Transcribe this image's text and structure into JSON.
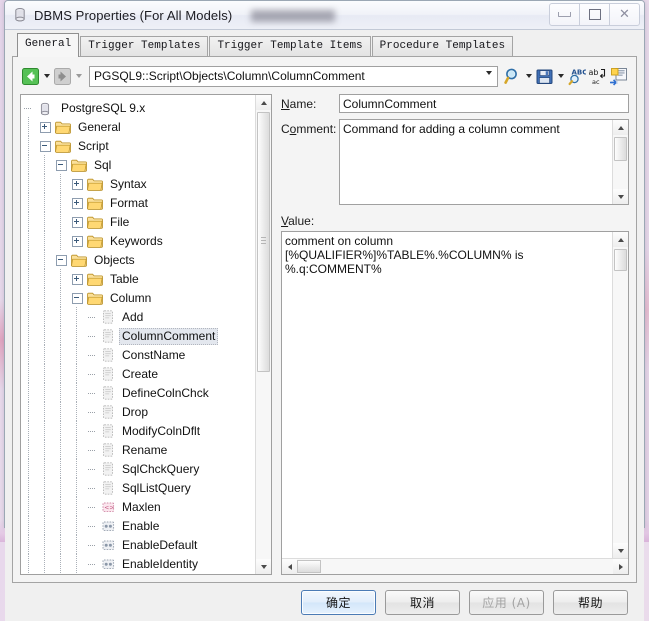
{
  "window": {
    "title": "DBMS Properties (For All Models)",
    "title_icon": "database-cylinder-icon",
    "minimize_label": "Minimize",
    "maximize_label": "Maximize",
    "close_label": "Close"
  },
  "tabs": [
    {
      "label": "General",
      "active": true
    },
    {
      "label": "Trigger Templates",
      "active": false
    },
    {
      "label": "Trigger Template Items",
      "active": false
    },
    {
      "label": "Procedure Templates",
      "active": false
    }
  ],
  "toolbar": {
    "back_icon": "back-arrow-icon",
    "forward_icon": "forward-arrow-icon",
    "path_value": "PGSQL9::Script\\Objects\\Column\\ColumnComment",
    "path_placeholder": "",
    "find_icon": "magnifier-icon",
    "save_icon": "floppy-disk-icon",
    "spellcheck_icon": "abc-spellcheck-icon",
    "replace_icon": "ab-ac-replace-icon",
    "insert_icon": "insert-template-icon"
  },
  "tree": {
    "root_icon": "database-cylinder-icon",
    "nodes": [
      {
        "label": "PostgreSQL 9.x",
        "depth": 0,
        "icon": "database-cylinder-icon",
        "expander": "none",
        "selected": false
      },
      {
        "label": "General",
        "depth": 1,
        "icon": "folder-icon",
        "expander": "plus",
        "selected": false
      },
      {
        "label": "Script",
        "depth": 1,
        "icon": "folder-icon",
        "expander": "minus",
        "selected": false
      },
      {
        "label": "Sql",
        "depth": 2,
        "icon": "folder-icon",
        "expander": "minus",
        "selected": false
      },
      {
        "label": "Syntax",
        "depth": 3,
        "icon": "folder-icon",
        "expander": "plus",
        "selected": false
      },
      {
        "label": "Format",
        "depth": 3,
        "icon": "folder-icon",
        "expander": "plus",
        "selected": false
      },
      {
        "label": "File",
        "depth": 3,
        "icon": "folder-icon",
        "expander": "plus",
        "selected": false
      },
      {
        "label": "Keywords",
        "depth": 3,
        "icon": "folder-icon",
        "expander": "plus",
        "selected": false
      },
      {
        "label": "Objects",
        "depth": 2,
        "icon": "folder-icon",
        "expander": "minus",
        "selected": false
      },
      {
        "label": "Table",
        "depth": 3,
        "icon": "folder-icon",
        "expander": "plus",
        "selected": false
      },
      {
        "label": "Column",
        "depth": 3,
        "icon": "folder-icon",
        "expander": "minus",
        "selected": false
      },
      {
        "label": "Add",
        "depth": 4,
        "icon": "script-item-icon",
        "expander": "none",
        "selected": false
      },
      {
        "label": "ColumnComment",
        "depth": 4,
        "icon": "script-item-icon",
        "expander": "none",
        "selected": true
      },
      {
        "label": "ConstName",
        "depth": 4,
        "icon": "script-item-icon",
        "expander": "none",
        "selected": false
      },
      {
        "label": "Create",
        "depth": 4,
        "icon": "script-item-icon",
        "expander": "none",
        "selected": false
      },
      {
        "label": "DefineColnChck",
        "depth": 4,
        "icon": "script-item-icon",
        "expander": "none",
        "selected": false
      },
      {
        "label": "Drop",
        "depth": 4,
        "icon": "script-item-icon",
        "expander": "none",
        "selected": false
      },
      {
        "label": "ModifyColnDflt",
        "depth": 4,
        "icon": "script-item-icon",
        "expander": "none",
        "selected": false
      },
      {
        "label": "Rename",
        "depth": 4,
        "icon": "script-item-icon",
        "expander": "none",
        "selected": false
      },
      {
        "label": "SqlChckQuery",
        "depth": 4,
        "icon": "script-item-icon",
        "expander": "none",
        "selected": false
      },
      {
        "label": "SqlListQuery",
        "depth": 4,
        "icon": "script-item-icon",
        "expander": "none",
        "selected": false
      },
      {
        "label": "Maxlen",
        "depth": 4,
        "icon": "number-value-icon",
        "expander": "none",
        "selected": false
      },
      {
        "label": "Enable",
        "depth": 4,
        "icon": "boolean-value-icon",
        "expander": "none",
        "selected": false
      },
      {
        "label": "EnableDefault",
        "depth": 4,
        "icon": "boolean-value-icon",
        "expander": "none",
        "selected": false
      },
      {
        "label": "EnableIdentity",
        "depth": 4,
        "icon": "boolean-value-icon",
        "expander": "none",
        "selected": false
      }
    ]
  },
  "form": {
    "name_label": "Name:",
    "name_accel": "N",
    "name_value": "ColumnComment",
    "comment_label": "Comment:",
    "comment_accel": "o",
    "comment_value": "Command for adding a column comment",
    "value_label": "Value:",
    "value_accel": "V",
    "value_value": "comment on column  [%QUALIFIER%]%TABLE%.%COLUMN% is %.q:COMMENT%"
  },
  "footer": {
    "ok_label": "确定",
    "cancel_label": "取消",
    "apply_label": "应用 (A)",
    "apply_accel": "A",
    "help_label": "帮助"
  },
  "colors": {
    "accent": "#4b7bb5",
    "selection": "#e3e7ee",
    "folder": "#ffd77a",
    "back_arrow": "#3fae3f",
    "window_bg": "#f0f0f0"
  }
}
